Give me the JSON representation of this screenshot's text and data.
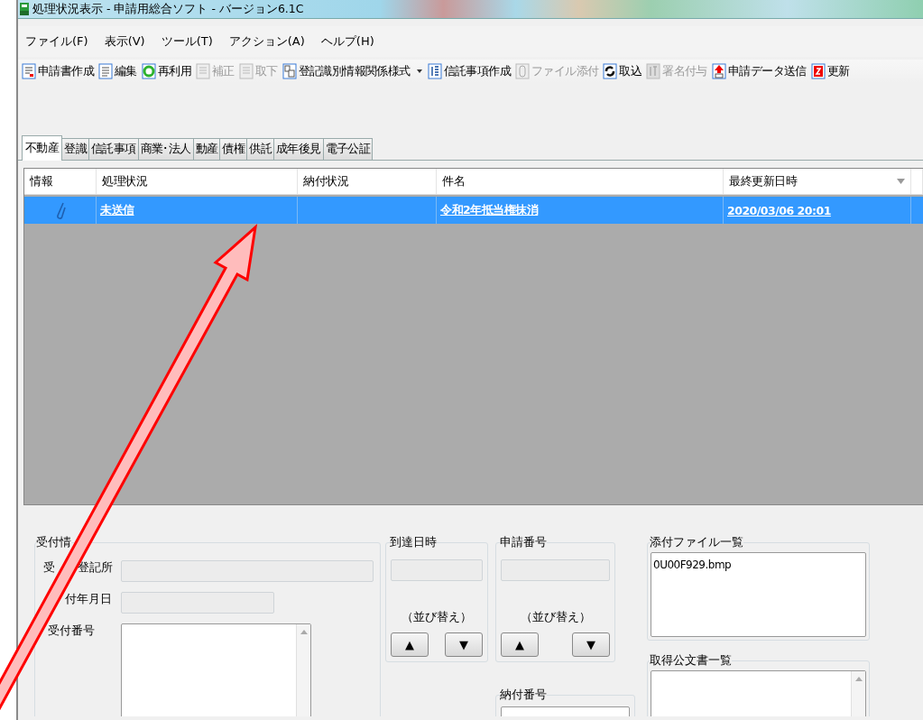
{
  "window": {
    "title": "処理状況表示 - 申請用総合ソフト - バージョン6.1C"
  },
  "menu": [
    "ファイル(F)",
    "表示(V)",
    "ツール(T)",
    "アクション(A)",
    "ヘルプ(H)"
  ],
  "toolbar": [
    {
      "label": "申請書作成",
      "disabled": false,
      "dropdown": false
    },
    {
      "label": "編集",
      "disabled": false,
      "dropdown": false
    },
    {
      "label": "再利用",
      "disabled": false,
      "dropdown": false
    },
    {
      "label": "補正",
      "disabled": true,
      "dropdown": false
    },
    {
      "label": "取下",
      "disabled": true,
      "dropdown": false
    },
    {
      "label": "登記識別情報関係様式",
      "disabled": false,
      "dropdown": true
    },
    {
      "label": "信託事項作成",
      "disabled": false,
      "dropdown": false
    },
    {
      "label": "ファイル添付",
      "disabled": true,
      "dropdown": false
    },
    {
      "label": "取込",
      "disabled": false,
      "dropdown": false
    },
    {
      "label": "署名付与",
      "disabled": true,
      "dropdown": false
    },
    {
      "label": "申請データ送信",
      "disabled": false,
      "dropdown": false
    },
    {
      "label": "更新",
      "disabled": false,
      "dropdown": false
    }
  ],
  "tabs": [
    {
      "label": "不動産",
      "selected": true
    },
    {
      "label": "登識",
      "selected": false
    },
    {
      "label": "信託事項",
      "selected": false
    },
    {
      "label": "商業･法人",
      "selected": false
    },
    {
      "label": "動産",
      "selected": false
    },
    {
      "label": "債権",
      "selected": false
    },
    {
      "label": "供託",
      "selected": false
    },
    {
      "label": "成年後見",
      "selected": false
    },
    {
      "label": "電子公証",
      "selected": false
    }
  ],
  "table": {
    "columns": [
      {
        "label": "情報",
        "sorted": false
      },
      {
        "label": "処理状況",
        "sorted": false
      },
      {
        "label": "納付状況",
        "sorted": false
      },
      {
        "label": "件名",
        "sorted": false
      },
      {
        "label": "最終更新日時",
        "sorted": true
      }
    ],
    "rows": [
      {
        "selected": true,
        "attachment": true,
        "status": "未送信",
        "subject": "令和2年抵当権抹消",
        "updated": "2020/03/06 20:01"
      }
    ]
  },
  "reception": {
    "title": "受付情",
    "fields": [
      {
        "label_parts": [
          "受",
          "登記所"
        ],
        "kind": "text"
      },
      {
        "label_parts": [
          "付年月日"
        ],
        "kind": "short"
      },
      {
        "label_parts": [
          "受付番号"
        ],
        "kind": "list"
      }
    ]
  },
  "sort_groups": [
    {
      "title": "到達日時",
      "sort_label": "（並び替え）",
      "up": "▲",
      "down": "▼"
    },
    {
      "title": "申請番号",
      "sort_label": "（並び替え）",
      "up": "▲",
      "down": "▼"
    }
  ],
  "payment_number": {
    "title": "納付番号"
  },
  "attachments": {
    "title": "添付ファイル一覧",
    "items": [
      "0U00F929.bmp"
    ]
  },
  "documents": {
    "title": "取得公文書一覧"
  }
}
